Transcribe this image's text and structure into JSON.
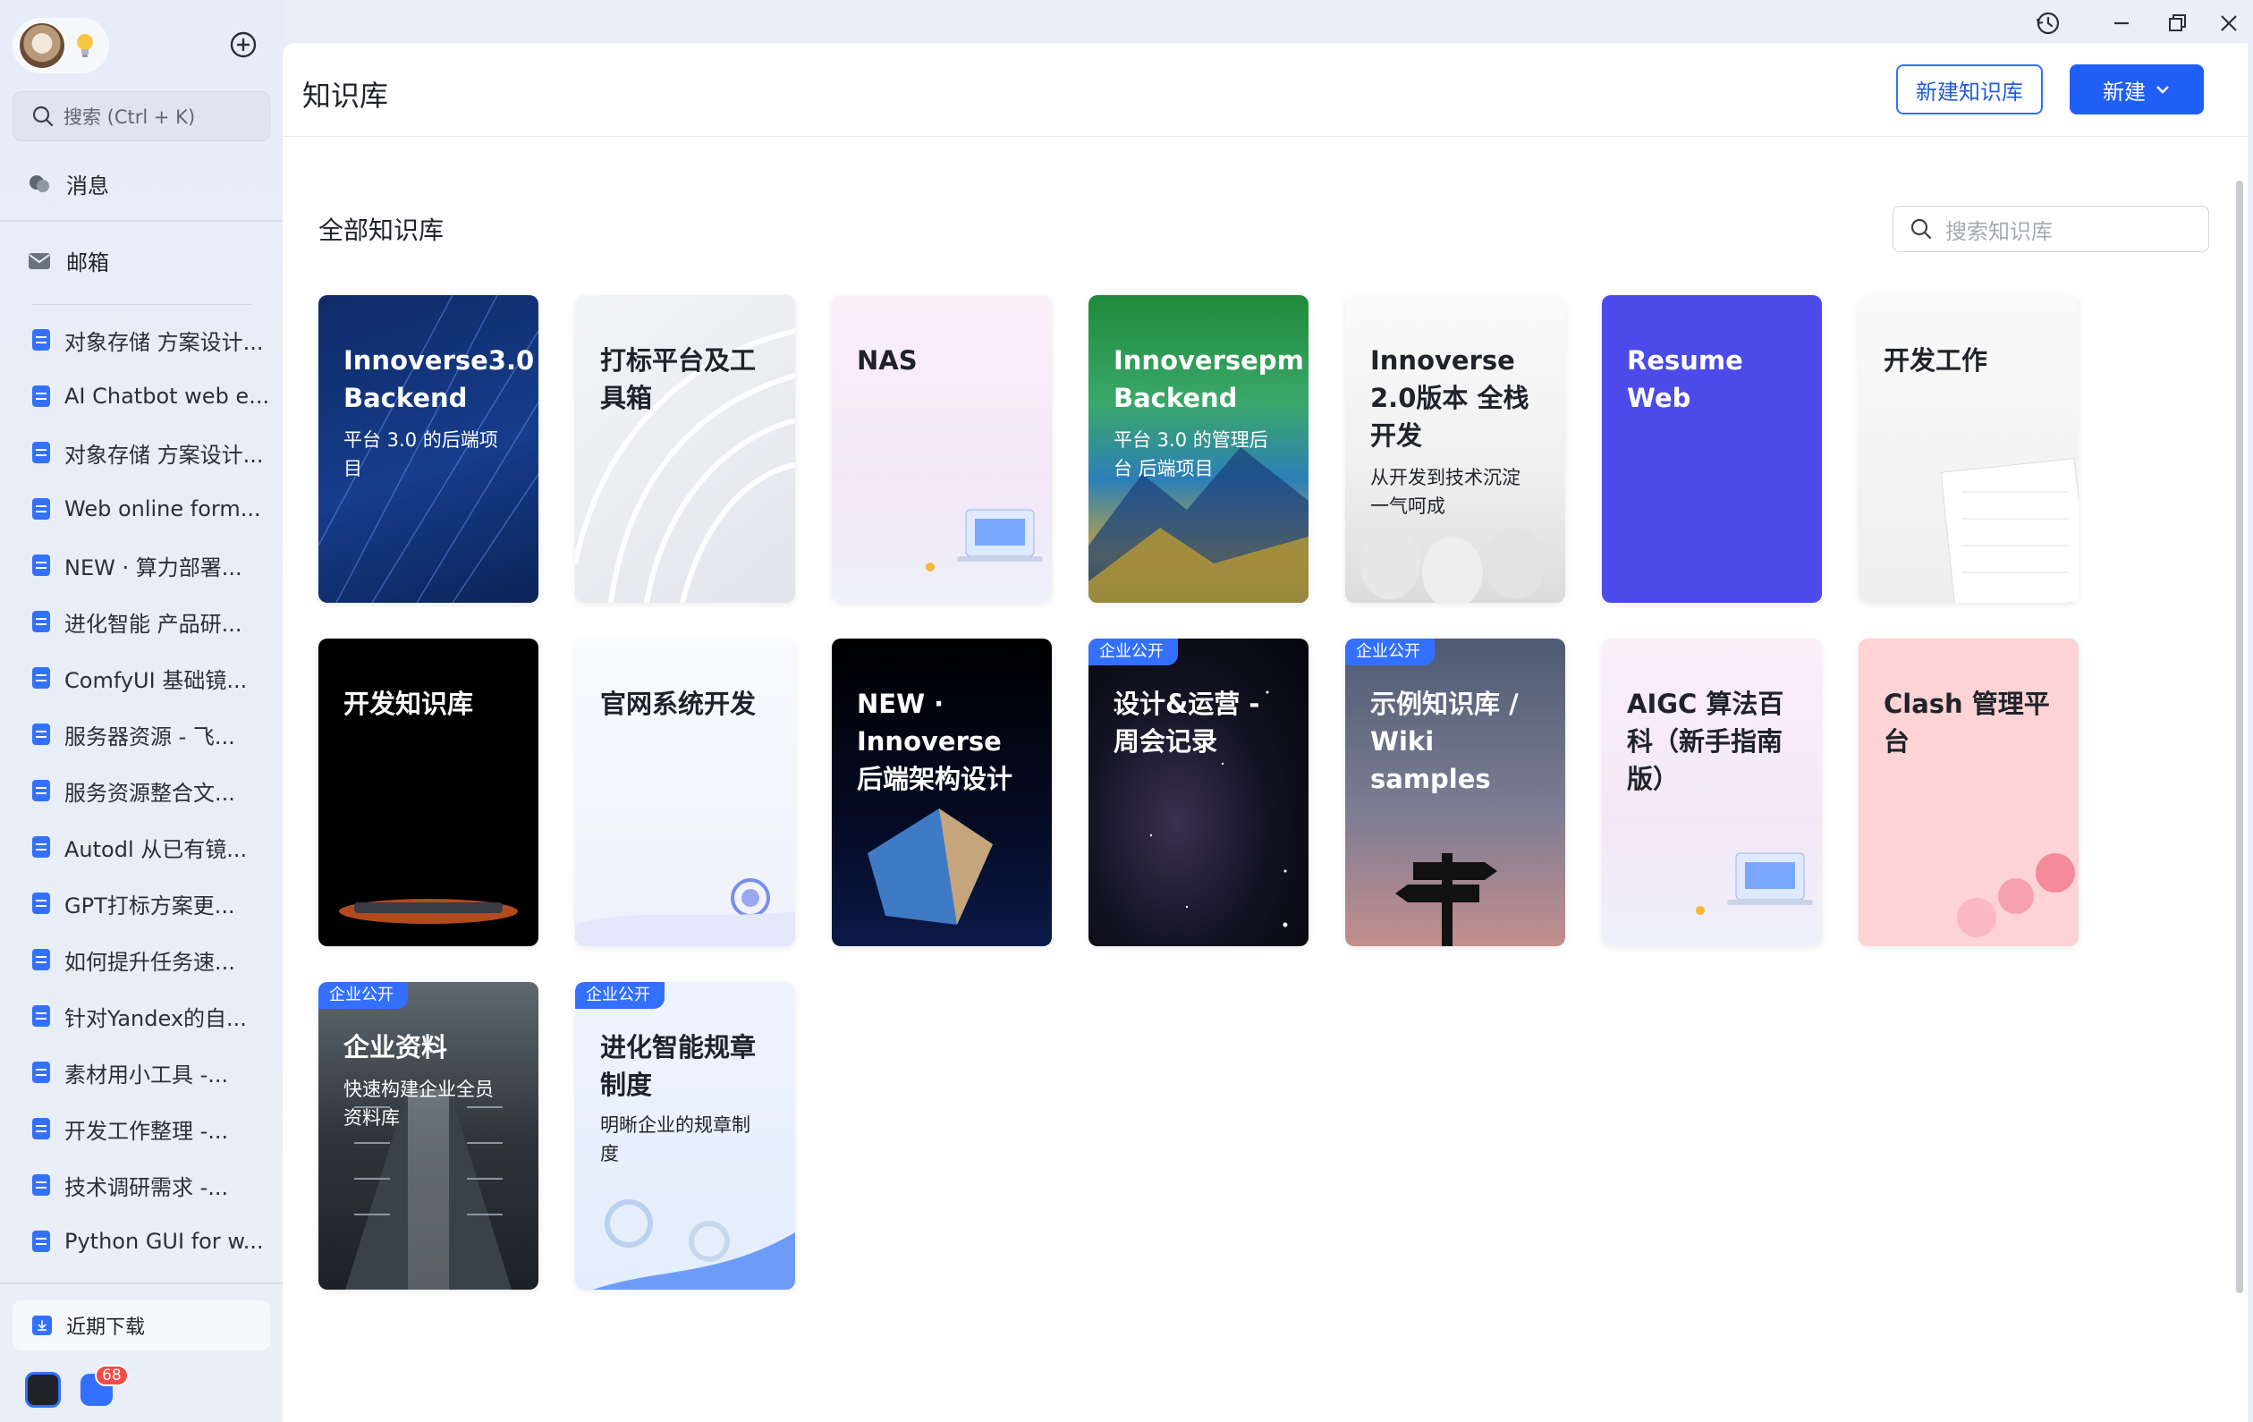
{
  "sidebar": {
    "search_placeholder": "搜索 (Ctrl + K)",
    "messages_label": "消息",
    "mail_label": "邮箱",
    "docs": [
      "对象存储 方案设计...",
      "AI Chatbot web e...",
      "对象存储 方案设计...",
      "Web online form...",
      "NEW · 算力部署...",
      "进化智能 产品研...",
      "ComfyUI 基础镜...",
      "服务器资源 - 飞...",
      "服务资源整合文...",
      "Autodl 从已有镜...",
      "GPT打标方案更...",
      "如何提升任务速...",
      "针对Yandex的自...",
      "素材用小工具 -...",
      "开发工作整理 -...",
      "技术调研需求 -...",
      "Python GUI for w..."
    ],
    "downloads_label": "近期下载",
    "badge_count": "68"
  },
  "header": {
    "title": "知识库",
    "new_kb_button": "新建知识库",
    "new_button": "新建"
  },
  "main": {
    "section_title": "全部知识库",
    "search_placeholder": "搜索知识库"
  },
  "cards": [
    {
      "title": "Innoverse3.0 Backend",
      "desc": "平台 3.0 的后端项目",
      "tag": ""
    },
    {
      "title": "打标平台及工具箱",
      "desc": "",
      "tag": ""
    },
    {
      "title": "NAS",
      "desc": "",
      "tag": ""
    },
    {
      "title": "Innoversepm Backend",
      "desc": "平台 3.0 的管理后台 后端项目",
      "tag": ""
    },
    {
      "title": "Innoverse 2.0版本 全栈开发",
      "desc": "从开发到技术沉淀一气呵成",
      "tag": ""
    },
    {
      "title": "Resume Web",
      "desc": "",
      "tag": ""
    },
    {
      "title": "开发工作",
      "desc": "",
      "tag": ""
    },
    {
      "title": "开发知识库",
      "desc": "",
      "tag": ""
    },
    {
      "title": "官网系统开发",
      "desc": "",
      "tag": ""
    },
    {
      "title": "NEW · Innoverse 后端架构设计",
      "desc": "",
      "tag": ""
    },
    {
      "title": "设计&运营 - 周会记录",
      "desc": "",
      "tag": "企业公开"
    },
    {
      "title": "示例知识库 / Wiki samples",
      "desc": "",
      "tag": "企业公开"
    },
    {
      "title": "AIGC 算法百科（新手指南版）",
      "desc": "",
      "tag": ""
    },
    {
      "title": "Clash 管理平台",
      "desc": "",
      "tag": ""
    },
    {
      "title": "企业资料",
      "desc": "快速构建企业全员资料库",
      "tag": "企业公开"
    },
    {
      "title": "进化智能规章制度",
      "desc": "明晰企业的规章制度",
      "tag": "企业公开"
    }
  ],
  "colors": {
    "accent": "#3370ff",
    "resume_card": "#4c4ae8",
    "clash_card": "#fdd3d5"
  }
}
